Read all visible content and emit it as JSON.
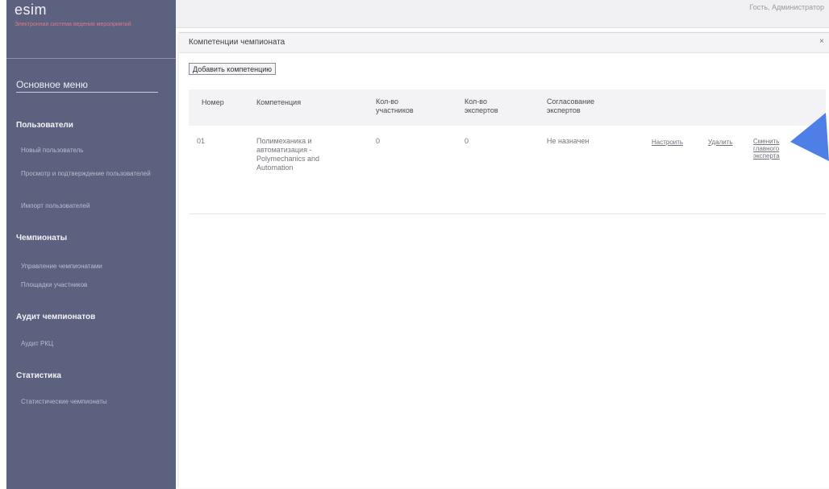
{
  "sidebar": {
    "brand": "esim",
    "brand_sub": "Электронная система ведения мероприятий",
    "menu_title": "Основное меню",
    "sections": [
      {
        "title": "Пользователи",
        "items": [
          "Новый пользователь",
          "Просмотр и подтверждение пользователей",
          "Импорт пользователей"
        ]
      },
      {
        "title": "Чемпионаты",
        "items": [
          "Управление чемпионатами",
          "Площадки участников"
        ]
      },
      {
        "title": "Аудит чемпионатов",
        "items": [
          "Аудит РКЦ"
        ]
      },
      {
        "title": "Статистика",
        "items": [
          "Статистические чемпионаты"
        ]
      }
    ]
  },
  "topbar": {
    "user_label": "Гость, Администратор"
  },
  "dialog": {
    "title": "Компетенции чемпионата",
    "close_label": "×",
    "add_button": "Добавить компетенцию",
    "columns": [
      "Номер",
      "Компетенция",
      "Кол-во участников",
      "Кол-во экспертов",
      "Согласование экспертов"
    ],
    "rows": [
      {
        "number": "01",
        "competence": "Полимеханика и автоматизация - Polymechanics and Automation",
        "participants": "0",
        "experts": "0",
        "approval": "Не назначен",
        "actions": [
          "Настроить",
          "Удалить",
          "Сменить главного эксперта"
        ]
      }
    ]
  },
  "colors": {
    "sidebar_bg": "#5c6180",
    "cursor": "#4d7fe6"
  }
}
